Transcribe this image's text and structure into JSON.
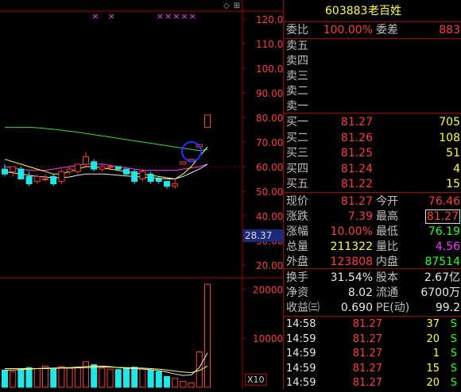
{
  "header": {
    "code": "603883",
    "name": "老百姓"
  },
  "top_buttons": {
    "left_label": "◇",
    "right_label": "⊞"
  },
  "chart": {
    "y_ticks": [
      "120.00",
      "110.00",
      "100.00",
      "90.00",
      "80.00",
      "70.00",
      "60.00",
      "50.00",
      "40.00",
      "30.00",
      "20.00"
    ],
    "y_ticks_values": [
      120,
      110,
      100,
      90,
      80,
      70,
      60,
      50,
      40,
      30,
      20
    ],
    "price_range": [
      20,
      125
    ],
    "current_price_tag": "28.37",
    "vol_ticks": [
      "20000",
      "10000"
    ],
    "vol_ticks_values": [
      20000,
      10000
    ],
    "vol_range": [
      0,
      22000
    ],
    "vol_unit": "X10",
    "marker_glyph": "×",
    "top_markers_x_index": [
      11,
      13,
      19,
      20,
      21,
      22,
      23
    ],
    "candles": [
      {
        "o": 59,
        "h": 61,
        "l": 56,
        "c": 57
      },
      {
        "o": 58,
        "h": 60,
        "l": 56,
        "c": 60
      },
      {
        "o": 59,
        "h": 60,
        "l": 55,
        "c": 55
      },
      {
        "o": 56,
        "h": 58,
        "l": 52,
        "c": 53
      },
      {
        "o": 54,
        "h": 57,
        "l": 53,
        "c": 56
      },
      {
        "o": 55,
        "h": 57,
        "l": 54,
        "c": 55
      },
      {
        "o": 56,
        "h": 57,
        "l": 52,
        "c": 53
      },
      {
        "o": 54,
        "h": 59,
        "l": 53,
        "c": 58
      },
      {
        "o": 58,
        "h": 60,
        "l": 57,
        "c": 59
      },
      {
        "o": 58,
        "h": 61,
        "l": 57,
        "c": 61
      },
      {
        "o": 61,
        "h": 66,
        "l": 60,
        "c": 64
      },
      {
        "o": 62,
        "h": 63,
        "l": 58,
        "c": 59
      },
      {
        "o": 59,
        "h": 61,
        "l": 58,
        "c": 60
      },
      {
        "o": 60,
        "h": 61,
        "l": 59,
        "c": 60
      },
      {
        "o": 60,
        "h": 60,
        "l": 58,
        "c": 59
      },
      {
        "o": 59,
        "h": 59,
        "l": 56,
        "c": 57
      },
      {
        "o": 58,
        "h": 59,
        "l": 53,
        "c": 54
      },
      {
        "o": 55,
        "h": 59,
        "l": 54,
        "c": 58
      },
      {
        "o": 57,
        "h": 58,
        "l": 53,
        "c": 54
      },
      {
        "o": 55,
        "h": 56,
        "l": 53,
        "c": 54
      },
      {
        "o": 54,
        "h": 54,
        "l": 51,
        "c": 52
      },
      {
        "o": 52,
        "h": 55,
        "l": 51,
        "c": 53
      },
      {
        "o": 61,
        "h": 62,
        "l": 61,
        "c": 62
      },
      {
        "o": 62,
        "h": 63,
        "l": 62,
        "c": 63
      },
      {
        "o": 68,
        "h": 69,
        "l": 68,
        "c": 69
      },
      {
        "o": 76,
        "h": 81,
        "l": 76,
        "c": 81
      }
    ],
    "ma_green": [
      76,
      76,
      76,
      76,
      75.8,
      75.5,
      75.2,
      74.8,
      74.4,
      74,
      73.5,
      73,
      72.5,
      72,
      71.5,
      71,
      70.5,
      70,
      69.5,
      69,
      68.5,
      68,
      67.5,
      67,
      66.5,
      67
    ],
    "ma_yellow": [
      63,
      62,
      61,
      60,
      59,
      58,
      57,
      57,
      58,
      59,
      60,
      60,
      59.5,
      59,
      58.5,
      58,
      57.5,
      57,
      56.5,
      56,
      55.5,
      55,
      57,
      60,
      64,
      68
    ],
    "ma_magenta": [
      60,
      59.5,
      59,
      58.5,
      58.5,
      58.5,
      59,
      59.5,
      60,
      60.5,
      61,
      61,
      61,
      60.5,
      60,
      59.5,
      59,
      58.5,
      58.5,
      58.5,
      58.5,
      58.5,
      59,
      59.5,
      60,
      61
    ],
    "ma_white": [
      58,
      57.5,
      57,
      56.5,
      56,
      55.8,
      55.5,
      55.5,
      55.8,
      56.5,
      57,
      57,
      57,
      56.8,
      56.5,
      56.2,
      56,
      55.8,
      55.5,
      55.3,
      55,
      55,
      56,
      57.5,
      59,
      61
    ],
    "volumes": [
      3500,
      3200,
      3600,
      4000,
      3800,
      4300,
      3700,
      4200,
      3900,
      4100,
      5200,
      4600,
      3900,
      3700,
      3600,
      3900,
      4100,
      3700,
      3500,
      3200,
      2200,
      1800,
      1200,
      900,
      7200,
      21000
    ],
    "vol_ma_white": [
      3500,
      3500,
      3600,
      3700,
      3800,
      3900,
      3900,
      4000,
      4000,
      4100,
      4200,
      4300,
      4300,
      4200,
      4000,
      3900,
      3800,
      3700,
      3600,
      3400,
      3100,
      2700,
      2400,
      2500,
      4000,
      7000
    ],
    "vol_ma_yellow": [
      3800,
      3800,
      3800,
      3800,
      3800,
      3800,
      3850,
      3900,
      3900,
      3950,
      4000,
      4050,
      4100,
      4100,
      4050,
      4000,
      3950,
      3900,
      3800,
      3700,
      3500,
      3300,
      3100,
      3000,
      3400,
      4300
    ]
  },
  "quote": {
    "weibi": {
      "label": "委比",
      "value": "100.00%",
      "label2": "委差",
      "value2": "883"
    },
    "sell": [
      {
        "label": "卖五"
      },
      {
        "label": "卖四"
      },
      {
        "label": "卖三"
      },
      {
        "label": "卖二"
      },
      {
        "label": "卖一"
      }
    ],
    "buy": [
      {
        "label": "买一",
        "price": "81.27",
        "qty": "705"
      },
      {
        "label": "买二",
        "price": "81.26",
        "qty": "108"
      },
      {
        "label": "买三",
        "price": "81.25",
        "qty": "51"
      },
      {
        "label": "买四",
        "price": "81.24",
        "qty": "4"
      },
      {
        "label": "买五",
        "price": "81.22",
        "qty": "15"
      }
    ],
    "stats": [
      {
        "l1": "现价",
        "v1": "81.27",
        "l2": "今开",
        "v2": "76.46"
      },
      {
        "l1": "涨跌",
        "v1": "7.39",
        "l2": "最高",
        "v2": "81.27"
      },
      {
        "l1": "涨幅",
        "v1": "10.00%",
        "l2": "最低",
        "v2": "76.19"
      },
      {
        "l1": "总量",
        "v1": "211322",
        "l2": "量比",
        "v2": "4.56"
      },
      {
        "l1": "外盘",
        "v1": "123808",
        "l2": "内盘",
        "v2": "87514"
      }
    ],
    "finance": [
      {
        "l1": "换手",
        "v1": "31.54%",
        "l2": "股本",
        "v2": "2.67亿"
      },
      {
        "l1": "净资",
        "v1": "8.02",
        "l2": "流通",
        "v2": "6700万"
      },
      {
        "l1": "收益㈢",
        "v1": "0.690",
        "l2": "PE(动)",
        "v2": "99.2"
      }
    ],
    "ticks": [
      {
        "time": "14:58",
        "price": "81.27",
        "vol": "37",
        "side": "S"
      },
      {
        "time": "14:59",
        "price": "81.27",
        "vol": "20",
        "side": "S"
      },
      {
        "time": "14:59",
        "price": "81.27",
        "vol": "1",
        "side": "S"
      },
      {
        "time": "14:59",
        "price": "81.27",
        "vol": "15",
        "side": "S"
      },
      {
        "time": "14:59",
        "price": "81.27",
        "vol": "20",
        "side": "S"
      }
    ]
  },
  "colors": {
    "up": "#ff3a3a",
    "down": "#22e6e6",
    "border": "#aa0000",
    "text_red": "#ff3a3a",
    "text_yellow": "#ffff33",
    "text_green": "#20ff20",
    "ma_green": "#33dd33",
    "ma_yellow": "#ffff33",
    "ma_magenta": "#ff33ff",
    "ma_white": "#e8e8e8"
  }
}
